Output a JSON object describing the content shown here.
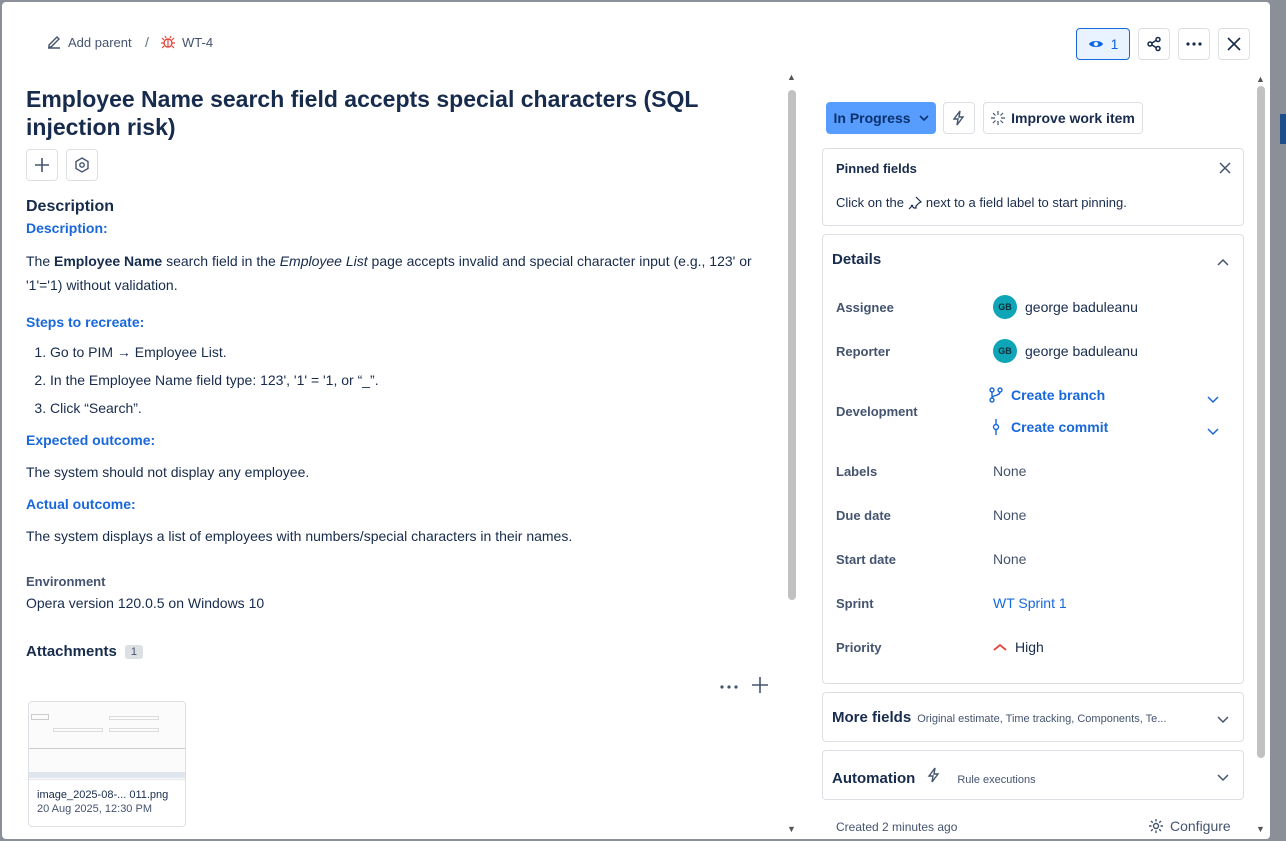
{
  "breadcrumb": {
    "add_parent": "Add parent",
    "separator": "/",
    "issue_key": "WT-4"
  },
  "header": {
    "watch_count": "1"
  },
  "issue": {
    "title": "Employee Name search field accepts special characters (SQL injection risk)",
    "description_heading": "Description",
    "desc_label": "Description:",
    "desc_text_pre": "The ",
    "desc_bold": "Employee Name",
    "desc_text_mid": " search field in the ",
    "desc_italic": "Employee List",
    "desc_text_post": " page accepts invalid and special character input (e.g., 123' or '1'='1) without validation.",
    "steps_label": "Steps to recreate:",
    "steps": [
      "Go to PIM → Employee List.",
      "In the Employee Name field type: 123', '1' = '1, or “_”.",
      "Click “Search”."
    ],
    "expected_label": "Expected outcome:",
    "expected_text": "The system should not display any employee.",
    "actual_label": "Actual outcome:",
    "actual_text": "The system displays a list of employees with numbers/special characters in their names.",
    "environment_label": "Environment",
    "environment_value": "Opera version 120.0.5 on Windows 10"
  },
  "attachments": {
    "label": "Attachments",
    "count": "1",
    "items": [
      {
        "filename": "image_2025-08-... 011.png",
        "date": "20 Aug 2025, 12:30 PM"
      }
    ]
  },
  "sidebar": {
    "status": "In Progress",
    "improve": "Improve work item",
    "pinned_title": "Pinned fields",
    "pinned_hint_pre": "Click on the",
    "pinned_hint_post": "next to a field label to start pinning.",
    "details_title": "Details",
    "fields": {
      "assignee_label": "Assignee",
      "assignee_value": "george baduleanu",
      "assignee_initials": "GB",
      "reporter_label": "Reporter",
      "reporter_value": "george baduleanu",
      "reporter_initials": "GB",
      "development_label": "Development",
      "create_branch": "Create branch",
      "create_commit": "Create commit",
      "labels_label": "Labels",
      "labels_value": "None",
      "due_label": "Due date",
      "due_value": "None",
      "start_label": "Start date",
      "start_value": "None",
      "sprint_label": "Sprint",
      "sprint_value": "WT Sprint 1",
      "priority_label": "Priority",
      "priority_value": "High"
    },
    "more_fields_title": "More fields",
    "more_fields_sub": "Original estimate, Time tracking, Components, Te...",
    "automation_title": "Automation",
    "automation_sub": "Rule executions",
    "created": "Created 2 minutes ago",
    "configure": "Configure"
  },
  "colors": {
    "accent": "#1868db",
    "status_bg": "#579dff",
    "priority": "#e2483d"
  }
}
